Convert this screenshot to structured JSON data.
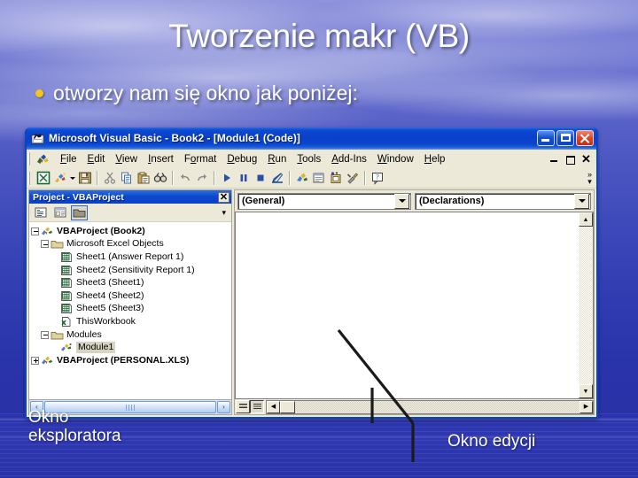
{
  "slide": {
    "title": "Tworzenie makr (VB)",
    "bullet": "otworzy nam się okno jak poniżej:",
    "callout_left": "Okno\neksploratora",
    "callout_left_line1": "Okno",
    "callout_left_line2": "eksploratora",
    "callout_right": "Okno edycji",
    "bullet_color": "#f5c518",
    "background_color": "#3a3fc0"
  },
  "window": {
    "title": "Microsoft Visual Basic - Book2 - [Module1 (Code)]",
    "app_icon": "visual-basic-icon",
    "titlebar_color": "#0a40c9",
    "controls": [
      {
        "name": "minimize",
        "label": "_"
      },
      {
        "name": "maximize",
        "label": "□"
      },
      {
        "name": "close",
        "label": "✕"
      }
    ]
  },
  "menubar": {
    "icon": "vb-project-icon",
    "items": [
      {
        "label": "File",
        "accel": "F"
      },
      {
        "label": "Edit",
        "accel": "E"
      },
      {
        "label": "View",
        "accel": "V"
      },
      {
        "label": "Insert",
        "accel": "I"
      },
      {
        "label": "Format",
        "accel": "o"
      },
      {
        "label": "Debug",
        "accel": "D"
      },
      {
        "label": "Run",
        "accel": "R"
      },
      {
        "label": "Tools",
        "accel": "T"
      },
      {
        "label": "Add-Ins",
        "accel": "A"
      },
      {
        "label": "Window",
        "accel": "W"
      },
      {
        "label": "Help",
        "accel": "H"
      }
    ],
    "mdi_controls": [
      {
        "name": "mdi-minimize",
        "label": "_"
      },
      {
        "name": "mdi-restore",
        "label": "⧉"
      },
      {
        "name": "mdi-close",
        "label": "✕"
      }
    ]
  },
  "toolbar": {
    "overflow_label": "»",
    "buttons": [
      {
        "name": "view-excel-icon",
        "tip": "View Microsoft Excel"
      },
      {
        "name": "insert-object-icon",
        "tip": "Insert"
      },
      {
        "name": "save-icon",
        "tip": "Save Book2"
      },
      {
        "name": "cut-icon",
        "tip": "Cut"
      },
      {
        "name": "copy-icon",
        "tip": "Copy"
      },
      {
        "name": "paste-icon",
        "tip": "Paste"
      },
      {
        "name": "find-icon",
        "tip": "Find"
      },
      {
        "name": "undo-icon",
        "tip": "Undo"
      },
      {
        "name": "redo-icon",
        "tip": "Redo"
      },
      {
        "name": "run-icon",
        "tip": "Run Sub/UserForm"
      },
      {
        "name": "pause-icon",
        "tip": "Break"
      },
      {
        "name": "stop-icon",
        "tip": "Reset"
      },
      {
        "name": "design-mode-icon",
        "tip": "Design Mode"
      },
      {
        "name": "project-explorer-icon",
        "tip": "Project Explorer"
      },
      {
        "name": "properties-window-icon",
        "tip": "Properties Window"
      },
      {
        "name": "object-browser-icon",
        "tip": "Object Browser"
      },
      {
        "name": "toolbox-icon",
        "tip": "Toolbox"
      },
      {
        "name": "help-icon",
        "tip": "Help"
      }
    ]
  },
  "project_explorer": {
    "caption": "Project - VBAProject",
    "close_label": "✕",
    "toolbar_buttons": [
      {
        "name": "view-code-icon"
      },
      {
        "name": "view-object-icon"
      },
      {
        "name": "toggle-folders-icon"
      }
    ],
    "more_label": "▾",
    "tree": [
      {
        "label": "VBAProject (Book2)",
        "indent": 0,
        "expander": "minus",
        "icon": "project-icon",
        "bold": true,
        "selected": false
      },
      {
        "label": "Microsoft Excel Objects",
        "indent": 1,
        "expander": "minus",
        "icon": "folder-icon",
        "bold": false,
        "selected": false
      },
      {
        "label": "Sheet1 (Answer Report 1)",
        "indent": 2,
        "expander": "none",
        "icon": "sheet-icon",
        "bold": false,
        "selected": false
      },
      {
        "label": "Sheet2 (Sensitivity Report 1)",
        "indent": 2,
        "expander": "none",
        "icon": "sheet-icon",
        "bold": false,
        "selected": false
      },
      {
        "label": "Sheet3 (Sheet1)",
        "indent": 2,
        "expander": "none",
        "icon": "sheet-icon",
        "bold": false,
        "selected": false
      },
      {
        "label": "Sheet4 (Sheet2)",
        "indent": 2,
        "expander": "none",
        "icon": "sheet-icon",
        "bold": false,
        "selected": false
      },
      {
        "label": "Sheet5 (Sheet3)",
        "indent": 2,
        "expander": "none",
        "icon": "sheet-icon",
        "bold": false,
        "selected": false
      },
      {
        "label": "ThisWorkbook",
        "indent": 2,
        "expander": "none",
        "icon": "workbook-icon",
        "bold": false,
        "selected": false
      },
      {
        "label": "Modules",
        "indent": 1,
        "expander": "minus",
        "icon": "folder-icon",
        "bold": false,
        "selected": false
      },
      {
        "label": "Module1",
        "indent": 2,
        "expander": "none",
        "icon": "module-icon",
        "bold": false,
        "selected": true
      },
      {
        "label": "VBAProject (PERSONAL.XLS)",
        "indent": 0,
        "expander": "plus",
        "icon": "project-icon",
        "bold": true,
        "selected": false
      }
    ],
    "hscroll": {
      "left_label": "‹",
      "right_label": "›"
    }
  },
  "code_window": {
    "object_combo": {
      "value": "(General)",
      "name": "object-dropdown"
    },
    "procedure_combo": {
      "value": "(Declarations)",
      "name": "procedure-dropdown"
    },
    "code_text": "",
    "view_buttons": [
      {
        "name": "procedure-view-button",
        "active": false
      },
      {
        "name": "full-module-view-button",
        "active": true
      }
    ],
    "vscroll": {
      "up_label": "▲",
      "down_label": "▼"
    },
    "hscroll": {
      "left_label": "◀",
      "right_label": "▶"
    }
  }
}
